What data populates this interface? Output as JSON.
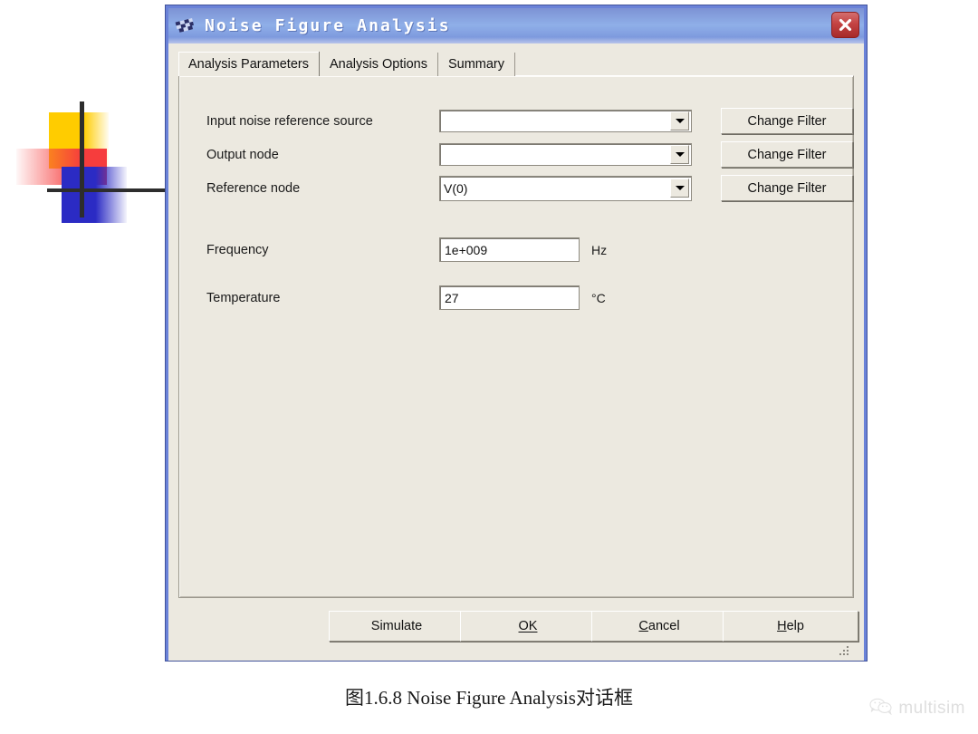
{
  "window": {
    "title": "Noise Figure Analysis",
    "title_icon": "checkered-flag-icon",
    "close_label": "✕",
    "border_color": "#6a82d8",
    "titlebar_gradient_from": "#7c92d4",
    "titlebar_gradient_to": "#8fafe8",
    "background_color": "#ece9e0",
    "close_button_color": "#c44343"
  },
  "tabs": [
    {
      "label": "Analysis Parameters",
      "selected": true
    },
    {
      "label": "Analysis Options",
      "selected": false
    },
    {
      "label": "Summary",
      "selected": false
    }
  ],
  "form": {
    "rows": [
      {
        "label": "Input noise reference source",
        "value": "",
        "control": "combobox",
        "button": "Change Filter"
      },
      {
        "label": "Output node",
        "value": "",
        "control": "combobox",
        "button": "Change Filter"
      },
      {
        "label": "Reference node",
        "value": "V(0)",
        "control": "combobox",
        "button": "Change Filter"
      }
    ],
    "frequency": {
      "label": "Frequency",
      "value": "1e+009",
      "unit": "Hz"
    },
    "temperature": {
      "label": "Temperature",
      "value": "27",
      "unit": "°C"
    }
  },
  "footer": {
    "buttons": [
      {
        "label": "Simulate",
        "accel": ""
      },
      {
        "label": "OK",
        "accel": "O"
      },
      {
        "label": "Cancel",
        "accel": "C"
      },
      {
        "label": "Help",
        "accel": "H"
      }
    ]
  },
  "caption": "图1.6.8 Noise Figure Analysis对话框",
  "watermark": {
    "text": "multisim",
    "icon": "wechat-icon",
    "color": "#a9a9a9"
  }
}
